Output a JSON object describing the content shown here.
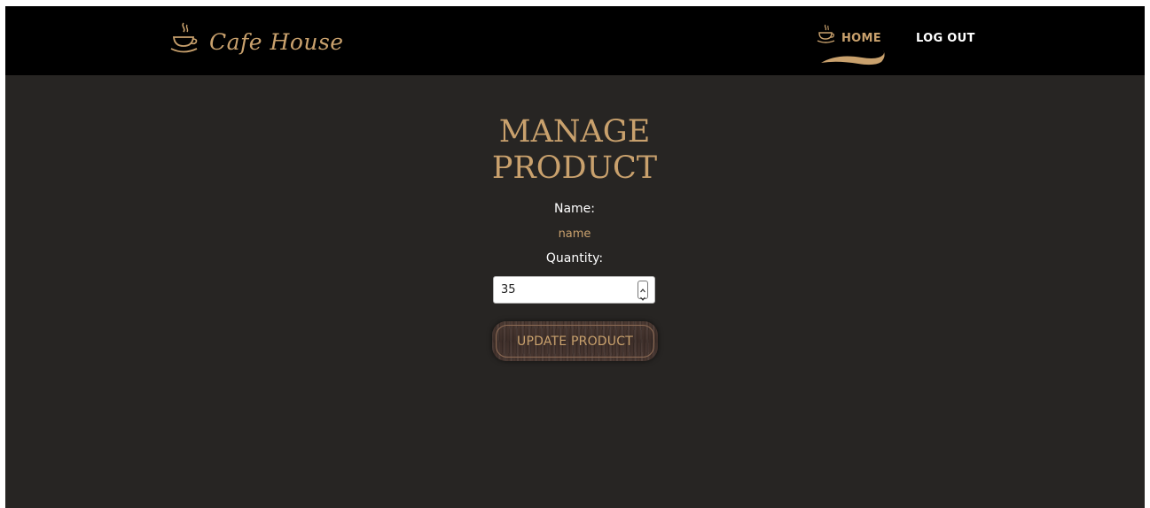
{
  "brand": {
    "name": "Cafe House",
    "icon": "coffee-cup-icon"
  },
  "nav": {
    "home_label": "HOME",
    "home_icon": "coffee-cup-icon",
    "logout_label": "LOG OUT"
  },
  "main": {
    "title_line1": "MANAGE",
    "title_line2": "PRODUCT",
    "name_label": "Name:",
    "name_value": "name",
    "quantity_label": "Quantity:",
    "quantity_value": "35",
    "submit_label": "UPDATE PRODUCT"
  },
  "colors": {
    "accent": "#c9a16d",
    "navbar": "#000000",
    "background": "#272523",
    "button_wood": "#4a3832"
  }
}
